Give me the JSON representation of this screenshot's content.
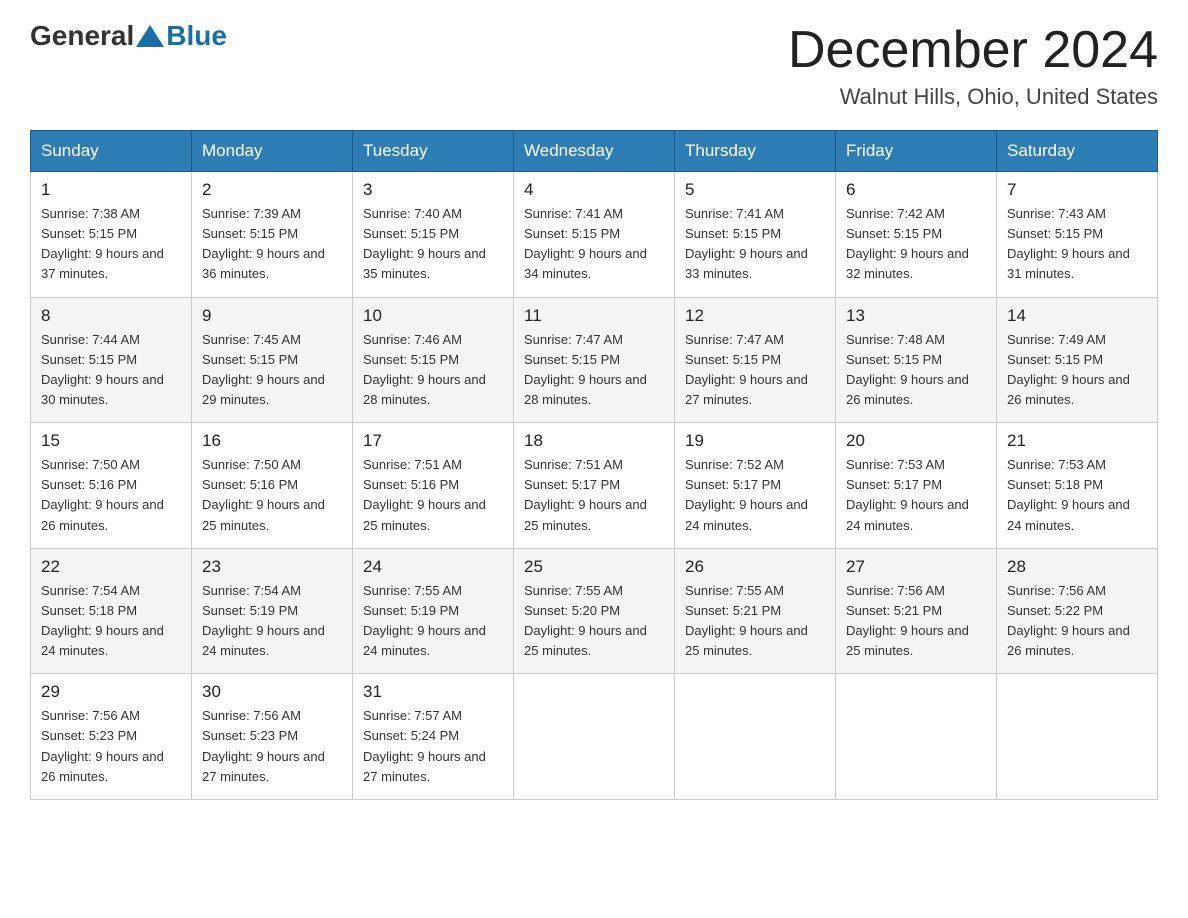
{
  "header": {
    "logo_general": "General",
    "logo_blue": "Blue",
    "month_title": "December 2024",
    "location": "Walnut Hills, Ohio, United States"
  },
  "days_of_week": [
    "Sunday",
    "Monday",
    "Tuesday",
    "Wednesday",
    "Thursday",
    "Friday",
    "Saturday"
  ],
  "weeks": [
    [
      {
        "day": "1",
        "sunrise": "7:38 AM",
        "sunset": "5:15 PM",
        "daylight": "9 hours and 37 minutes."
      },
      {
        "day": "2",
        "sunrise": "7:39 AM",
        "sunset": "5:15 PM",
        "daylight": "9 hours and 36 minutes."
      },
      {
        "day": "3",
        "sunrise": "7:40 AM",
        "sunset": "5:15 PM",
        "daylight": "9 hours and 35 minutes."
      },
      {
        "day": "4",
        "sunrise": "7:41 AM",
        "sunset": "5:15 PM",
        "daylight": "9 hours and 34 minutes."
      },
      {
        "day": "5",
        "sunrise": "7:41 AM",
        "sunset": "5:15 PM",
        "daylight": "9 hours and 33 minutes."
      },
      {
        "day": "6",
        "sunrise": "7:42 AM",
        "sunset": "5:15 PM",
        "daylight": "9 hours and 32 minutes."
      },
      {
        "day": "7",
        "sunrise": "7:43 AM",
        "sunset": "5:15 PM",
        "daylight": "9 hours and 31 minutes."
      }
    ],
    [
      {
        "day": "8",
        "sunrise": "7:44 AM",
        "sunset": "5:15 PM",
        "daylight": "9 hours and 30 minutes."
      },
      {
        "day": "9",
        "sunrise": "7:45 AM",
        "sunset": "5:15 PM",
        "daylight": "9 hours and 29 minutes."
      },
      {
        "day": "10",
        "sunrise": "7:46 AM",
        "sunset": "5:15 PM",
        "daylight": "9 hours and 28 minutes."
      },
      {
        "day": "11",
        "sunrise": "7:47 AM",
        "sunset": "5:15 PM",
        "daylight": "9 hours and 28 minutes."
      },
      {
        "day": "12",
        "sunrise": "7:47 AM",
        "sunset": "5:15 PM",
        "daylight": "9 hours and 27 minutes."
      },
      {
        "day": "13",
        "sunrise": "7:48 AM",
        "sunset": "5:15 PM",
        "daylight": "9 hours and 26 minutes."
      },
      {
        "day": "14",
        "sunrise": "7:49 AM",
        "sunset": "5:15 PM",
        "daylight": "9 hours and 26 minutes."
      }
    ],
    [
      {
        "day": "15",
        "sunrise": "7:50 AM",
        "sunset": "5:16 PM",
        "daylight": "9 hours and 26 minutes."
      },
      {
        "day": "16",
        "sunrise": "7:50 AM",
        "sunset": "5:16 PM",
        "daylight": "9 hours and 25 minutes."
      },
      {
        "day": "17",
        "sunrise": "7:51 AM",
        "sunset": "5:16 PM",
        "daylight": "9 hours and 25 minutes."
      },
      {
        "day": "18",
        "sunrise": "7:51 AM",
        "sunset": "5:17 PM",
        "daylight": "9 hours and 25 minutes."
      },
      {
        "day": "19",
        "sunrise": "7:52 AM",
        "sunset": "5:17 PM",
        "daylight": "9 hours and 24 minutes."
      },
      {
        "day": "20",
        "sunrise": "7:53 AM",
        "sunset": "5:17 PM",
        "daylight": "9 hours and 24 minutes."
      },
      {
        "day": "21",
        "sunrise": "7:53 AM",
        "sunset": "5:18 PM",
        "daylight": "9 hours and 24 minutes."
      }
    ],
    [
      {
        "day": "22",
        "sunrise": "7:54 AM",
        "sunset": "5:18 PM",
        "daylight": "9 hours and 24 minutes."
      },
      {
        "day": "23",
        "sunrise": "7:54 AM",
        "sunset": "5:19 PM",
        "daylight": "9 hours and 24 minutes."
      },
      {
        "day": "24",
        "sunrise": "7:55 AM",
        "sunset": "5:19 PM",
        "daylight": "9 hours and 24 minutes."
      },
      {
        "day": "25",
        "sunrise": "7:55 AM",
        "sunset": "5:20 PM",
        "daylight": "9 hours and 25 minutes."
      },
      {
        "day": "26",
        "sunrise": "7:55 AM",
        "sunset": "5:21 PM",
        "daylight": "9 hours and 25 minutes."
      },
      {
        "day": "27",
        "sunrise": "7:56 AM",
        "sunset": "5:21 PM",
        "daylight": "9 hours and 25 minutes."
      },
      {
        "day": "28",
        "sunrise": "7:56 AM",
        "sunset": "5:22 PM",
        "daylight": "9 hours and 26 minutes."
      }
    ],
    [
      {
        "day": "29",
        "sunrise": "7:56 AM",
        "sunset": "5:23 PM",
        "daylight": "9 hours and 26 minutes."
      },
      {
        "day": "30",
        "sunrise": "7:56 AM",
        "sunset": "5:23 PM",
        "daylight": "9 hours and 27 minutes."
      },
      {
        "day": "31",
        "sunrise": "7:57 AM",
        "sunset": "5:24 PM",
        "daylight": "9 hours and 27 minutes."
      },
      null,
      null,
      null,
      null
    ]
  ]
}
